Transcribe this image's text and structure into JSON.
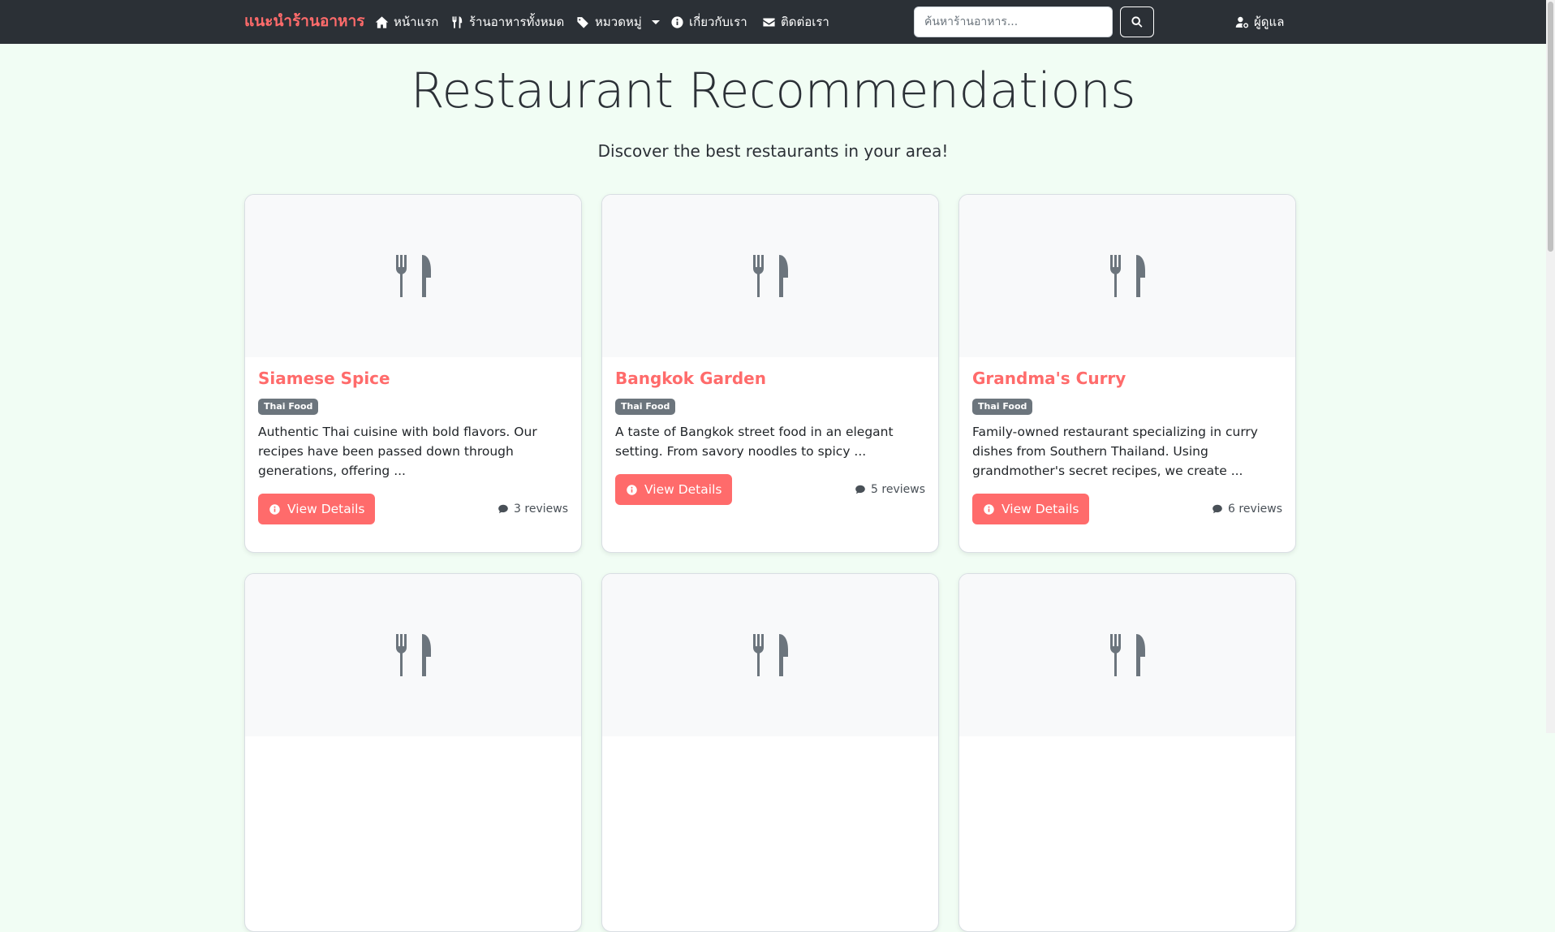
{
  "nav": {
    "brand": "แนะนำร้านอาหาร",
    "links": [
      {
        "label": "หน้าแรก",
        "icon": "home-icon"
      },
      {
        "label": "ร้านอาหารทั้งหมด",
        "icon": "utensils-icon"
      },
      {
        "label": "หมวดหมู่",
        "icon": "tags-icon",
        "dropdown": true
      },
      {
        "label": "เกี่ยวกับเรา",
        "icon": "info-circle-icon"
      },
      {
        "label": "ติดต่อเรา",
        "icon": "envelope-icon"
      }
    ],
    "search_placeholder": "ค้นหาร้านอาหาร...",
    "admin_label": "ผู้ดูแล"
  },
  "hero": {
    "title": "Restaurant Recommendations",
    "subtitle": "Discover the best restaurants in your area!"
  },
  "restaurants": [
    {
      "name": "Siamese Spice",
      "category": "Thai Food",
      "description": "Authentic Thai cuisine with bold flavors. Our recipes have been passed down through generations, offering ...",
      "button_label": "View Details",
      "reviews": "3 reviews"
    },
    {
      "name": "Bangkok Garden",
      "category": "Thai Food",
      "description": "A taste of Bangkok street food in an elegant setting. From savory noodles to spicy ...",
      "button_label": "View Details",
      "reviews": "5 reviews"
    },
    {
      "name": "Grandma's Curry",
      "category": "Thai Food",
      "description": "Family-owned restaurant specializing in curry dishes from Southern Thailand. Using grandmother's secret recipes, we create ...",
      "button_label": "View Details",
      "reviews": "6 reviews"
    }
  ],
  "colors": {
    "accent": "#ff6b6b",
    "navbar": "#2b3036",
    "background": "#f1fdf4",
    "badge": "#6c757d"
  }
}
